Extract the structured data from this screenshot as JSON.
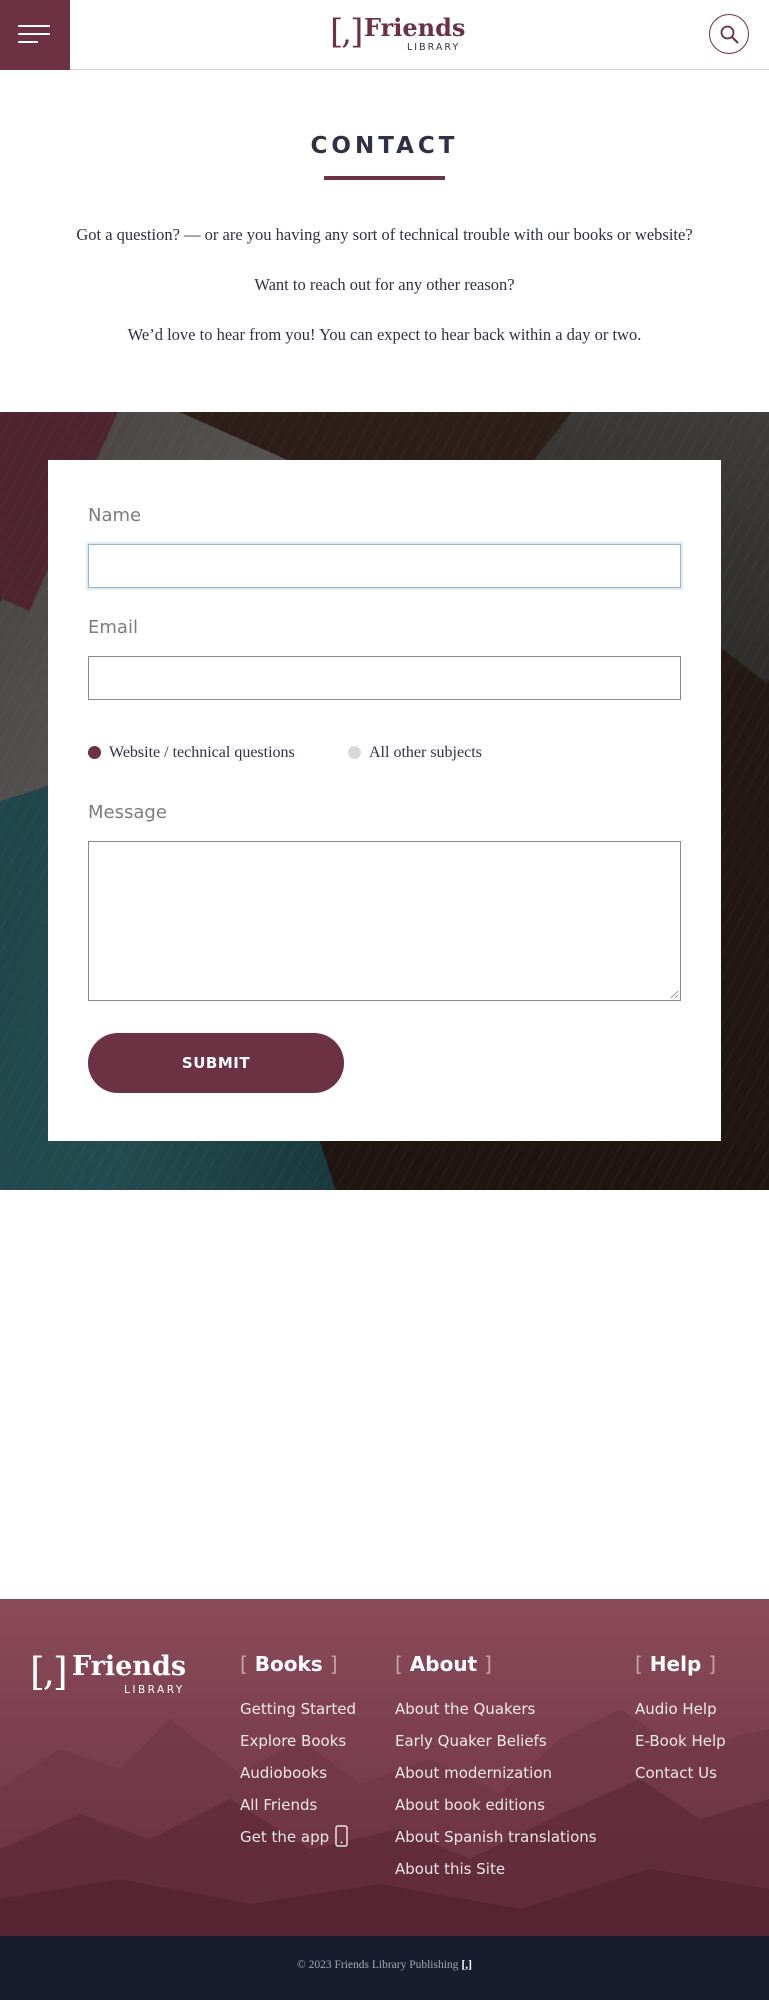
{
  "header": {
    "logo_bracket": "[,]",
    "logo_word": "Friends",
    "logo_sub": "LIBRARY"
  },
  "intro": {
    "title": "CONTACT",
    "line1": "Got a question? — or are you having any sort of technical trouble with our books or website?",
    "line2": "Want to reach out for any other reason?",
    "line3": "We’d love to hear from you! You can expect to hear back within a day or two."
  },
  "form": {
    "name_label": "Name",
    "name_value": "",
    "email_label": "Email",
    "email_value": "",
    "radio_technical_label": "Website / technical questions",
    "radio_technical_selected": true,
    "radio_other_label": "All other subjects",
    "radio_other_selected": false,
    "message_label": "Message",
    "message_value": "",
    "submit_label": "SUBMIT"
  },
  "footer": {
    "logo_bracket": "[,]",
    "logo_word": "Friends",
    "logo_sub": "LIBRARY",
    "books": {
      "open": "[",
      "heading": "Books",
      "close": "]",
      "links": [
        "Getting Started",
        "Explore Books",
        "Audiobooks",
        "All Friends",
        "Get the app"
      ]
    },
    "about": {
      "open": "[",
      "heading": "About",
      "close": "]",
      "links": [
        "About the Quakers",
        "Early Quaker Beliefs",
        "About modernization",
        "About book editions",
        "About Spanish translations",
        "About this Site"
      ]
    },
    "help": {
      "open": "[",
      "heading": "Help",
      "close": "]",
      "links": [
        "Audio Help",
        "E-Book Help",
        "Contact Us"
      ]
    },
    "copyright": "© 2023 Friends Library Publishing",
    "copyright_logo": "[,]"
  },
  "colors": {
    "brand": "#6c3142",
    "footer_bar": "#181c2e",
    "text": "#2f3045",
    "label_gray": "#7c7c7c",
    "radio_unselected": "#d8d8d8"
  },
  "icons": {
    "menu": "hamburger-menu-icon",
    "search": "search-icon",
    "phone": "phone-icon",
    "radio_selected": "radio-selected-icon",
    "radio_unselected": "radio-unselected-icon"
  }
}
